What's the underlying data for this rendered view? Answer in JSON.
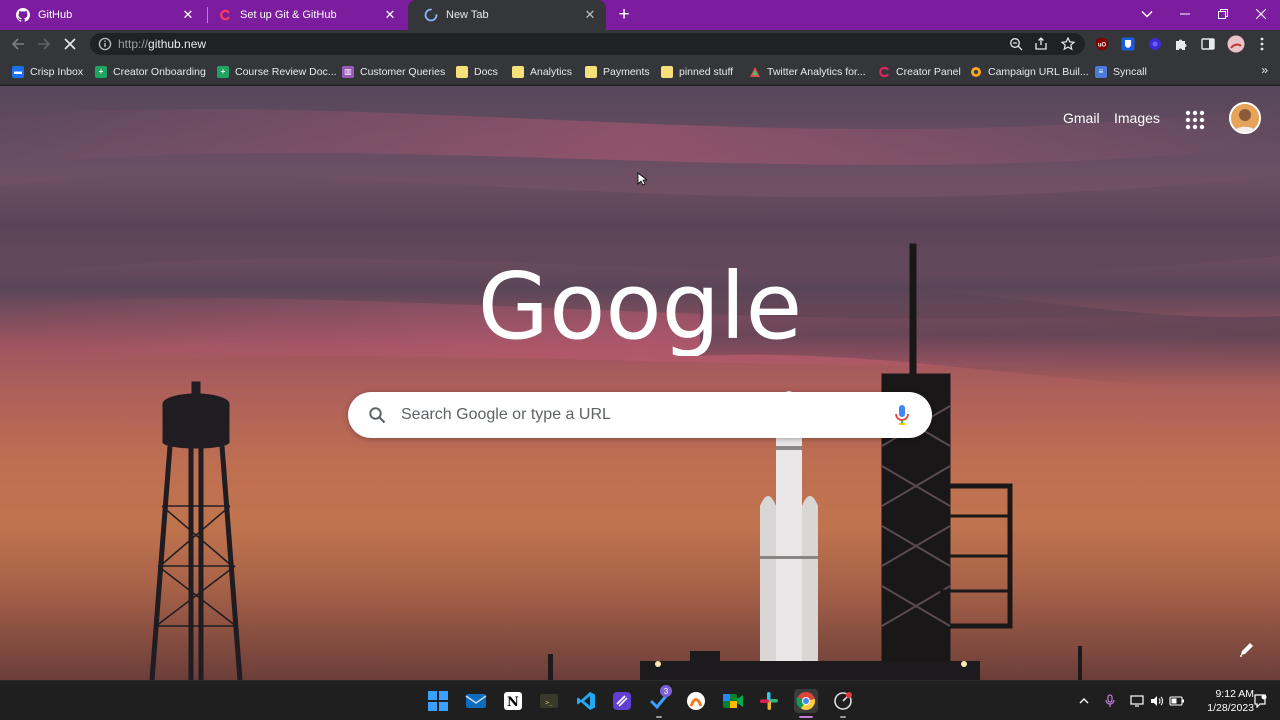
{
  "browser": {
    "tabs": [
      {
        "title": "GitHub",
        "icon": "github-icon",
        "active": false
      },
      {
        "title": "Set up Git & GitHub",
        "icon": "creator-c-icon",
        "active": false
      },
      {
        "title": "New Tab",
        "icon": "loading-spinner-icon",
        "active": true
      }
    ],
    "new_tab_label": "+",
    "address": {
      "scheme": "http://",
      "host": "github.new"
    }
  },
  "bookmarks": [
    {
      "label": "Crisp Inbox",
      "icon": "crisp-icon",
      "color": "#1972f5"
    },
    {
      "label": "Creator Onboarding",
      "icon": "sheets-icon",
      "color": "#1fa463"
    },
    {
      "label": "Course Review Doc...",
      "icon": "sheets-icon",
      "color": "#1fa463"
    },
    {
      "label": "Customer Queries",
      "icon": "trello-icon",
      "color": "#9b59b6"
    },
    {
      "label": "Docs",
      "icon": "folder-icon",
      "color": "#f7df7a"
    },
    {
      "label": "Analytics",
      "icon": "folder-icon",
      "color": "#f7df7a"
    },
    {
      "label": "Payments",
      "icon": "folder-icon",
      "color": "#f7df7a"
    },
    {
      "label": "pinned stuff",
      "icon": "folder-icon",
      "color": "#f7df7a"
    },
    {
      "label": "Twitter Analytics for...",
      "icon": "analytics-triangle-icon",
      "color": "#e34b4b"
    },
    {
      "label": "Creator Panel",
      "icon": "creator-c-icon",
      "color": "#e0245e"
    },
    {
      "label": "Campaign URL Buil...",
      "icon": "gear-icon",
      "color": "#f4a623"
    },
    {
      "label": "Syncall",
      "icon": "syncall-icon",
      "color": "#4a7bd8"
    }
  ],
  "newtab": {
    "gmail_label": "Gmail",
    "images_label": "Images",
    "logo_text": "Google",
    "search_placeholder": "Search Google or type a URL"
  },
  "taskbar": {
    "badge_count": "3",
    "time": "9:12 AM",
    "date": "1/28/2023"
  },
  "colors": {
    "tab_strip": "#7b1d9e",
    "toolbar": "#35363a",
    "taskbar": "#1f1f1f",
    "accent": "#c77bd8"
  }
}
